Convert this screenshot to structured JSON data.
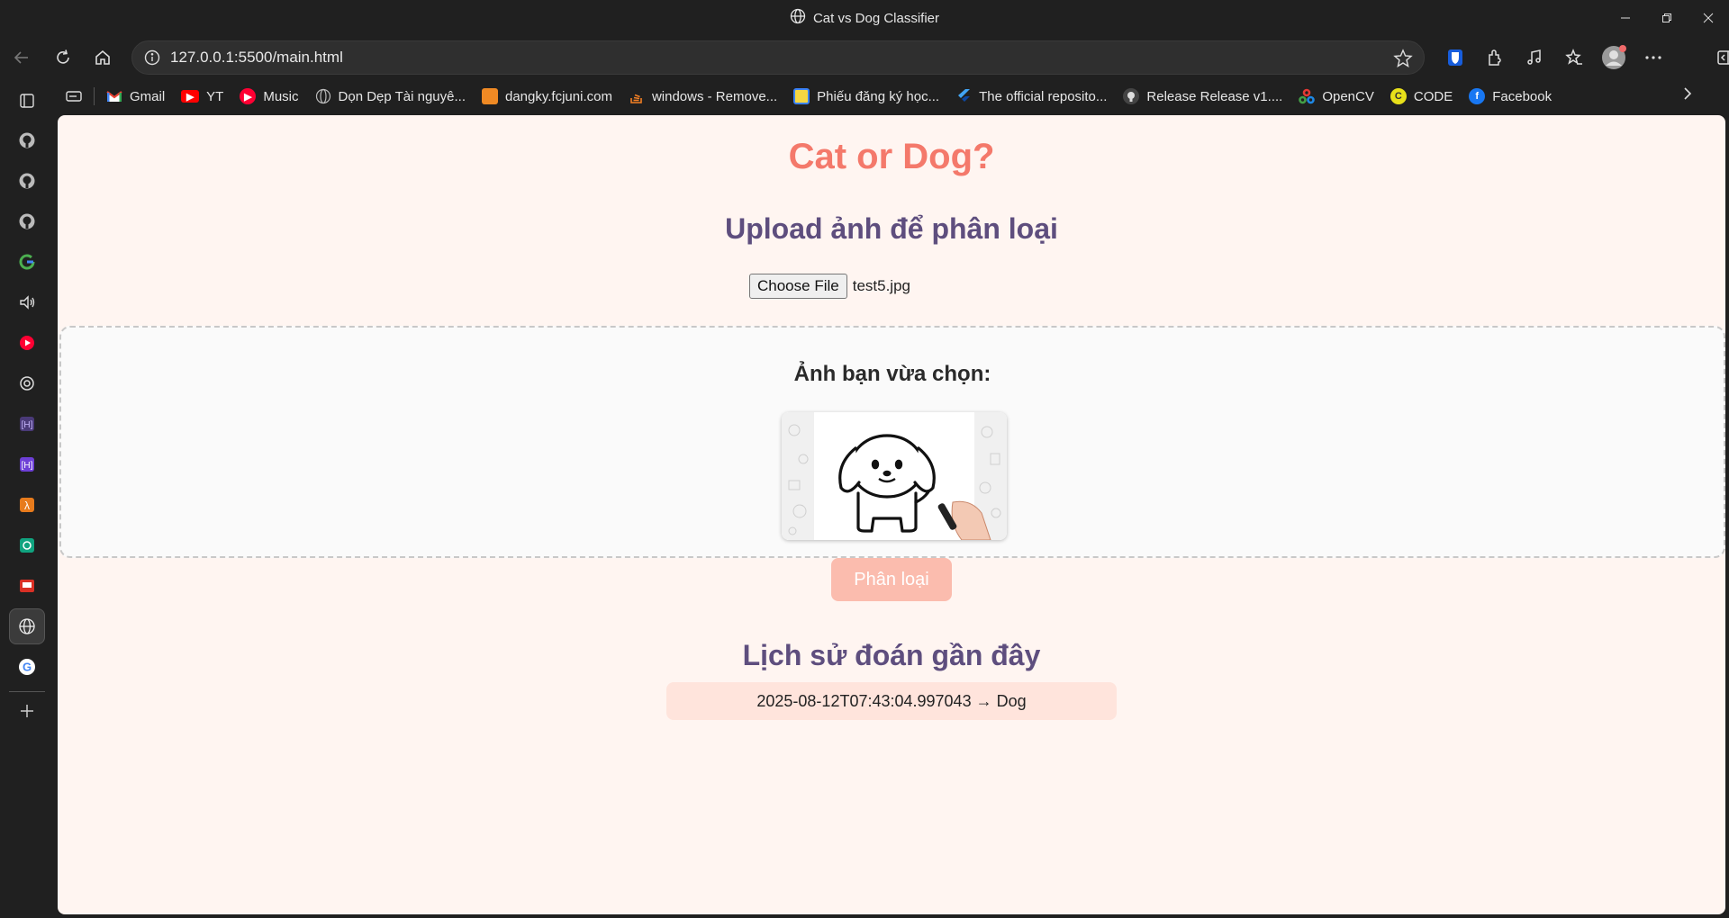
{
  "window": {
    "title": "Cat vs Dog Classifier"
  },
  "address_bar": {
    "url": "127.0.0.1:5500/main.html"
  },
  "bookmarks": [
    {
      "label": "Gmail",
      "icon": "gmail-icon",
      "color": "#ea4335"
    },
    {
      "label": "YT",
      "icon": "youtube-icon",
      "color": "#ff0000"
    },
    {
      "label": "Music",
      "icon": "youtube-music-icon",
      "color": "#ff0033"
    },
    {
      "label": "Dọn Dẹp Tài nguyê...",
      "icon": "globe-icon",
      "color": "#888888"
    },
    {
      "label": "dangky.fcjuni.com",
      "icon": "cube-icon",
      "color": "#f08a24"
    },
    {
      "label": "windows - Remove...",
      "icon": "stackoverflow-icon",
      "color": "#f48024"
    },
    {
      "label": "Phiếu đăng ký học...",
      "icon": "form-icon",
      "color": "#3b82f6"
    },
    {
      "label": "The official reposito...",
      "icon": "flutter-icon",
      "color": "#42a5f5"
    },
    {
      "label": "Release Release v1....",
      "icon": "github-icon",
      "color": "#bbbbbb"
    },
    {
      "label": "OpenCV",
      "icon": "opencv-icon",
      "color": "#5fbf3f"
    },
    {
      "label": "CODE",
      "icon": "code-icon",
      "color": "#e8e01a"
    },
    {
      "label": "Facebook",
      "icon": "facebook-icon",
      "color": "#1877f2"
    }
  ],
  "page": {
    "heading": "Cat or Dog?",
    "upload_heading": "Upload ảnh để phân loại",
    "file_button": "Choose File",
    "file_name": "test5.jpg",
    "preview_title": "Ảnh bạn vừa chọn:",
    "classify_button": "Phân loại",
    "history_heading": "Lịch sử đoán gần đây",
    "history": [
      {
        "entry": "2025-08-12T07:43:04.997043 → Dog"
      }
    ]
  },
  "colors": {
    "heading": "#f4796b",
    "subheading": "#5e4e7e",
    "page_bg": "#fff5f1",
    "button": "#fbbcae",
    "history_bg": "#ffe4dc"
  }
}
